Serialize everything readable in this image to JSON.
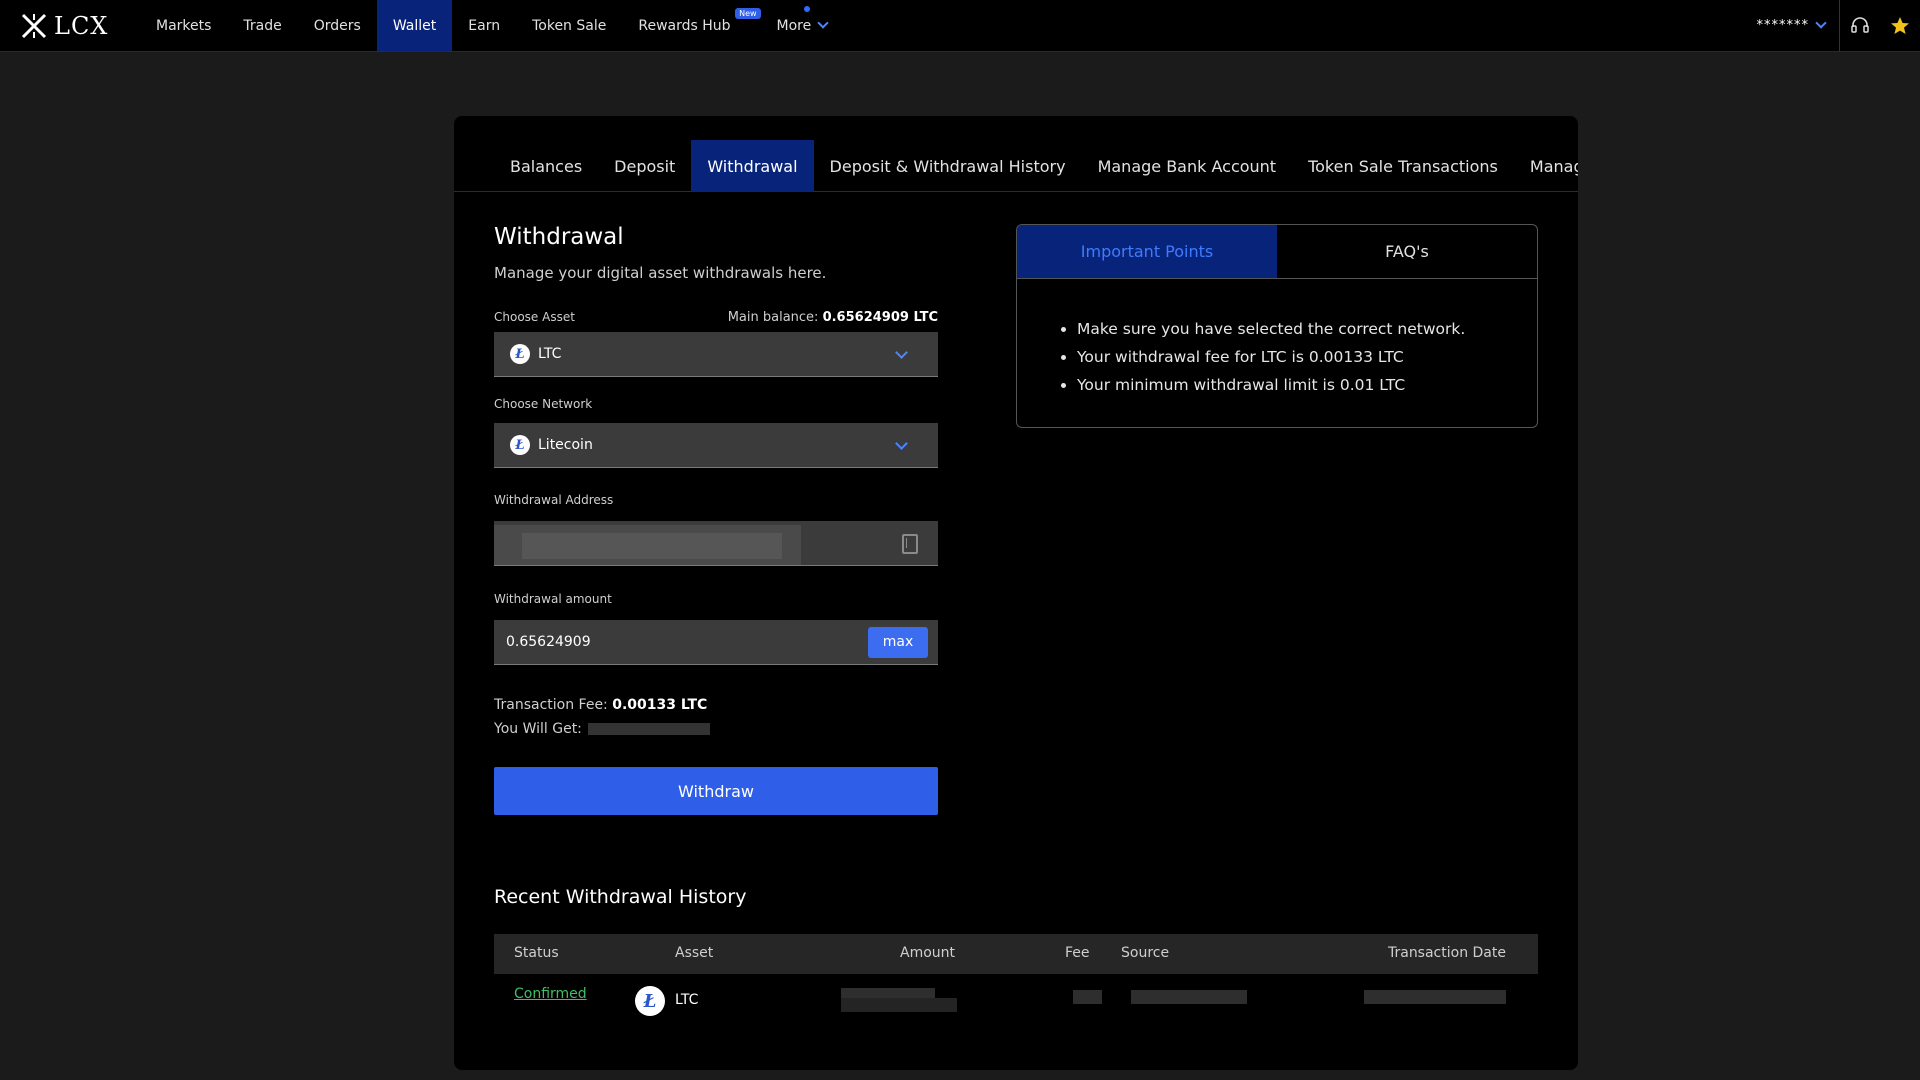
{
  "app": {
    "logo_text": "LCX"
  },
  "nav": {
    "items": [
      {
        "label": "Markets"
      },
      {
        "label": "Trade"
      },
      {
        "label": "Orders"
      },
      {
        "label": "Wallet"
      },
      {
        "label": "Earn"
      },
      {
        "label": "Token Sale"
      },
      {
        "label": "Rewards Hub",
        "badge": "New"
      },
      {
        "label": "More"
      }
    ],
    "user": "*******"
  },
  "tabs": [
    {
      "label": "Balances"
    },
    {
      "label": "Deposit"
    },
    {
      "label": "Withdrawal"
    },
    {
      "label": "Deposit & Withdrawal History"
    },
    {
      "label": "Manage Bank Account"
    },
    {
      "label": "Token Sale Transactions"
    },
    {
      "label": "Manage Withdra"
    }
  ],
  "withdrawal": {
    "title": "Withdrawal",
    "subtitle": "Manage your digital asset withdrawals here.",
    "choose_asset_label": "Choose Asset",
    "main_balance_label": "Main balance:",
    "main_balance_value": "0.65624909 LTC",
    "asset_value": "LTC",
    "choose_network_label": "Choose Network",
    "network_value": "Litecoin",
    "address_label": "Withdrawal Address",
    "amount_label": "Withdrawal amount",
    "amount_value": "0.65624909",
    "max_label": "max",
    "fee_label": "Transaction Fee:",
    "fee_value": "0.00133 LTC",
    "you_get_label": "You Will Get:",
    "withdraw_button": "Withdraw"
  },
  "info_panel": {
    "tab_points": "Important Points",
    "tab_faq": "FAQ's",
    "points": [
      "Make sure you have selected the correct network.",
      "Your withdrawal fee for LTC is 0.00133 LTC",
      "Your minimum withdrawal limit is 0.01 LTC"
    ]
  },
  "history": {
    "title": "Recent Withdrawal History",
    "headers": {
      "status": "Status",
      "asset": "Asset",
      "amount": "Amount",
      "fee": "Fee",
      "source": "Source",
      "date": "Transaction Date"
    },
    "rows": [
      {
        "status": "Confirmed",
        "asset": "LTC"
      }
    ]
  },
  "colors": {
    "accent": "#2f5fe8",
    "active_tab": "#08247a",
    "confirmed": "#42be65",
    "star": "#f1c21b"
  }
}
